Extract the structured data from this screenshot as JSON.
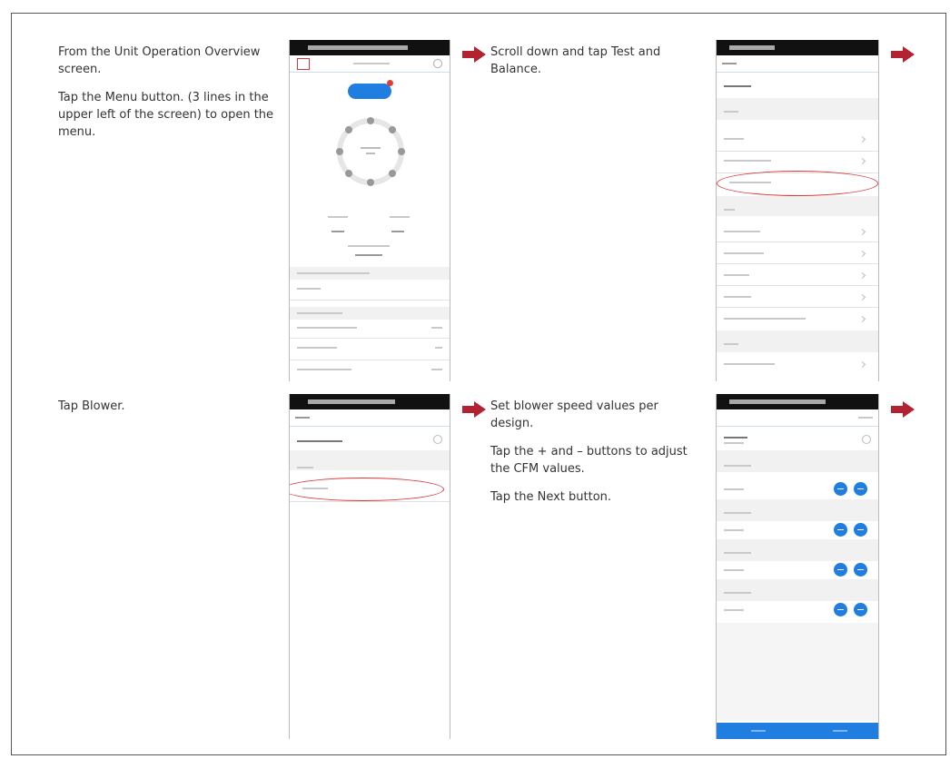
{
  "steps": [
    {
      "paragraphs": [
        "From the Unit Operation Overview screen.",
        "Tap the Menu button. (3 lines in the upper left of the screen) to open the menu."
      ]
    },
    {
      "paragraphs": [
        "Scroll down and tap Test and Balance."
      ]
    },
    {
      "paragraphs": [
        "Tap Blower."
      ]
    },
    {
      "paragraphs": [
        "Set blower speed values per design.",
        "Tap the + and – buttons to adjust the CFM values.",
        "Tap the Next button."
      ]
    }
  ],
  "colors": {
    "arrow": "#b32230",
    "highlight_oval": "#d9383a",
    "app_blue": "#1f7ee0"
  },
  "icons": [
    "right-arrow-icon",
    "menu-icon",
    "minus-button-icon",
    "plus-button-icon"
  ]
}
